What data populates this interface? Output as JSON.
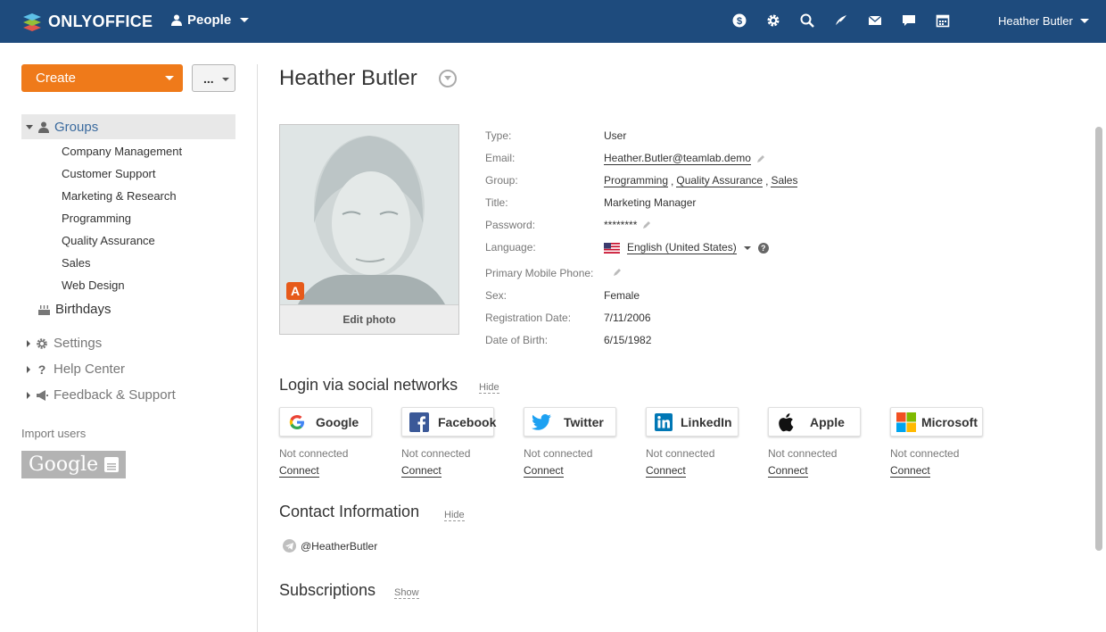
{
  "header": {
    "logo_text": "ONLYOFFICE",
    "module_label": "People",
    "icons": [
      "payments-icon",
      "settings-icon",
      "search-icon",
      "feed-icon",
      "mail-icon",
      "chat-icon",
      "calendar-icon"
    ],
    "user_name": "Heather Butler",
    "colors": {
      "bar": "#1e4b7d"
    }
  },
  "sidebar": {
    "create_label": "Create",
    "more_label": "...",
    "groups_label": "Groups",
    "groups": [
      "Company Management",
      "Customer Support",
      "Marketing & Research",
      "Programming",
      "Quality Assurance",
      "Sales",
      "Web Design"
    ],
    "birthdays_label": "Birthdays",
    "settings_label": "Settings",
    "help_label": "Help Center",
    "feedback_label": "Feedback & Support",
    "import_label": "Import users",
    "google_label": "Google",
    "colors": {
      "create": "#ef7a1a",
      "active_link": "#3a6a9e"
    }
  },
  "profile": {
    "name": "Heather Butler",
    "edit_photo_label": "Edit photo",
    "badge_letter": "A",
    "fields": {
      "type_label": "Type:",
      "type_value": "User",
      "email_label": "Email:",
      "email_value": "Heather.Butler@teamlab.demo",
      "group_label": "Group:",
      "group_1": "Programming",
      "group_2": "Quality Assurance",
      "group_3": "Sales",
      "group_sep": ",",
      "title_label": "Title:",
      "title_value": "Marketing Manager",
      "password_label": "Password:",
      "password_value": "********",
      "language_label": "Language:",
      "language_value": "English (United States)",
      "phone_label": "Primary Mobile Phone:",
      "sex_label": "Sex:",
      "sex_value": "Female",
      "reg_label": "Registration Date:",
      "reg_value": "7/11/2006",
      "dob_label": "Date of Birth:",
      "dob_value": "6/15/1982"
    }
  },
  "social": {
    "title": "Login via social networks",
    "toggle": "Hide",
    "networks": [
      {
        "name": "Google",
        "status": "Not connected",
        "action": "Connect"
      },
      {
        "name": "Facebook",
        "status": "Not connected",
        "action": "Connect"
      },
      {
        "name": "Twitter",
        "status": "Not connected",
        "action": "Connect"
      },
      {
        "name": "LinkedIn",
        "status": "Not connected",
        "action": "Connect"
      },
      {
        "name": "Apple",
        "status": "Not connected",
        "action": "Connect"
      },
      {
        "name": "Microsoft",
        "status": "Not connected",
        "action": "Connect"
      }
    ]
  },
  "contact": {
    "title": "Contact Information",
    "toggle": "Hide",
    "telegram": "@HeatherButler"
  },
  "subscriptions": {
    "title": "Subscriptions",
    "toggle": "Show"
  }
}
